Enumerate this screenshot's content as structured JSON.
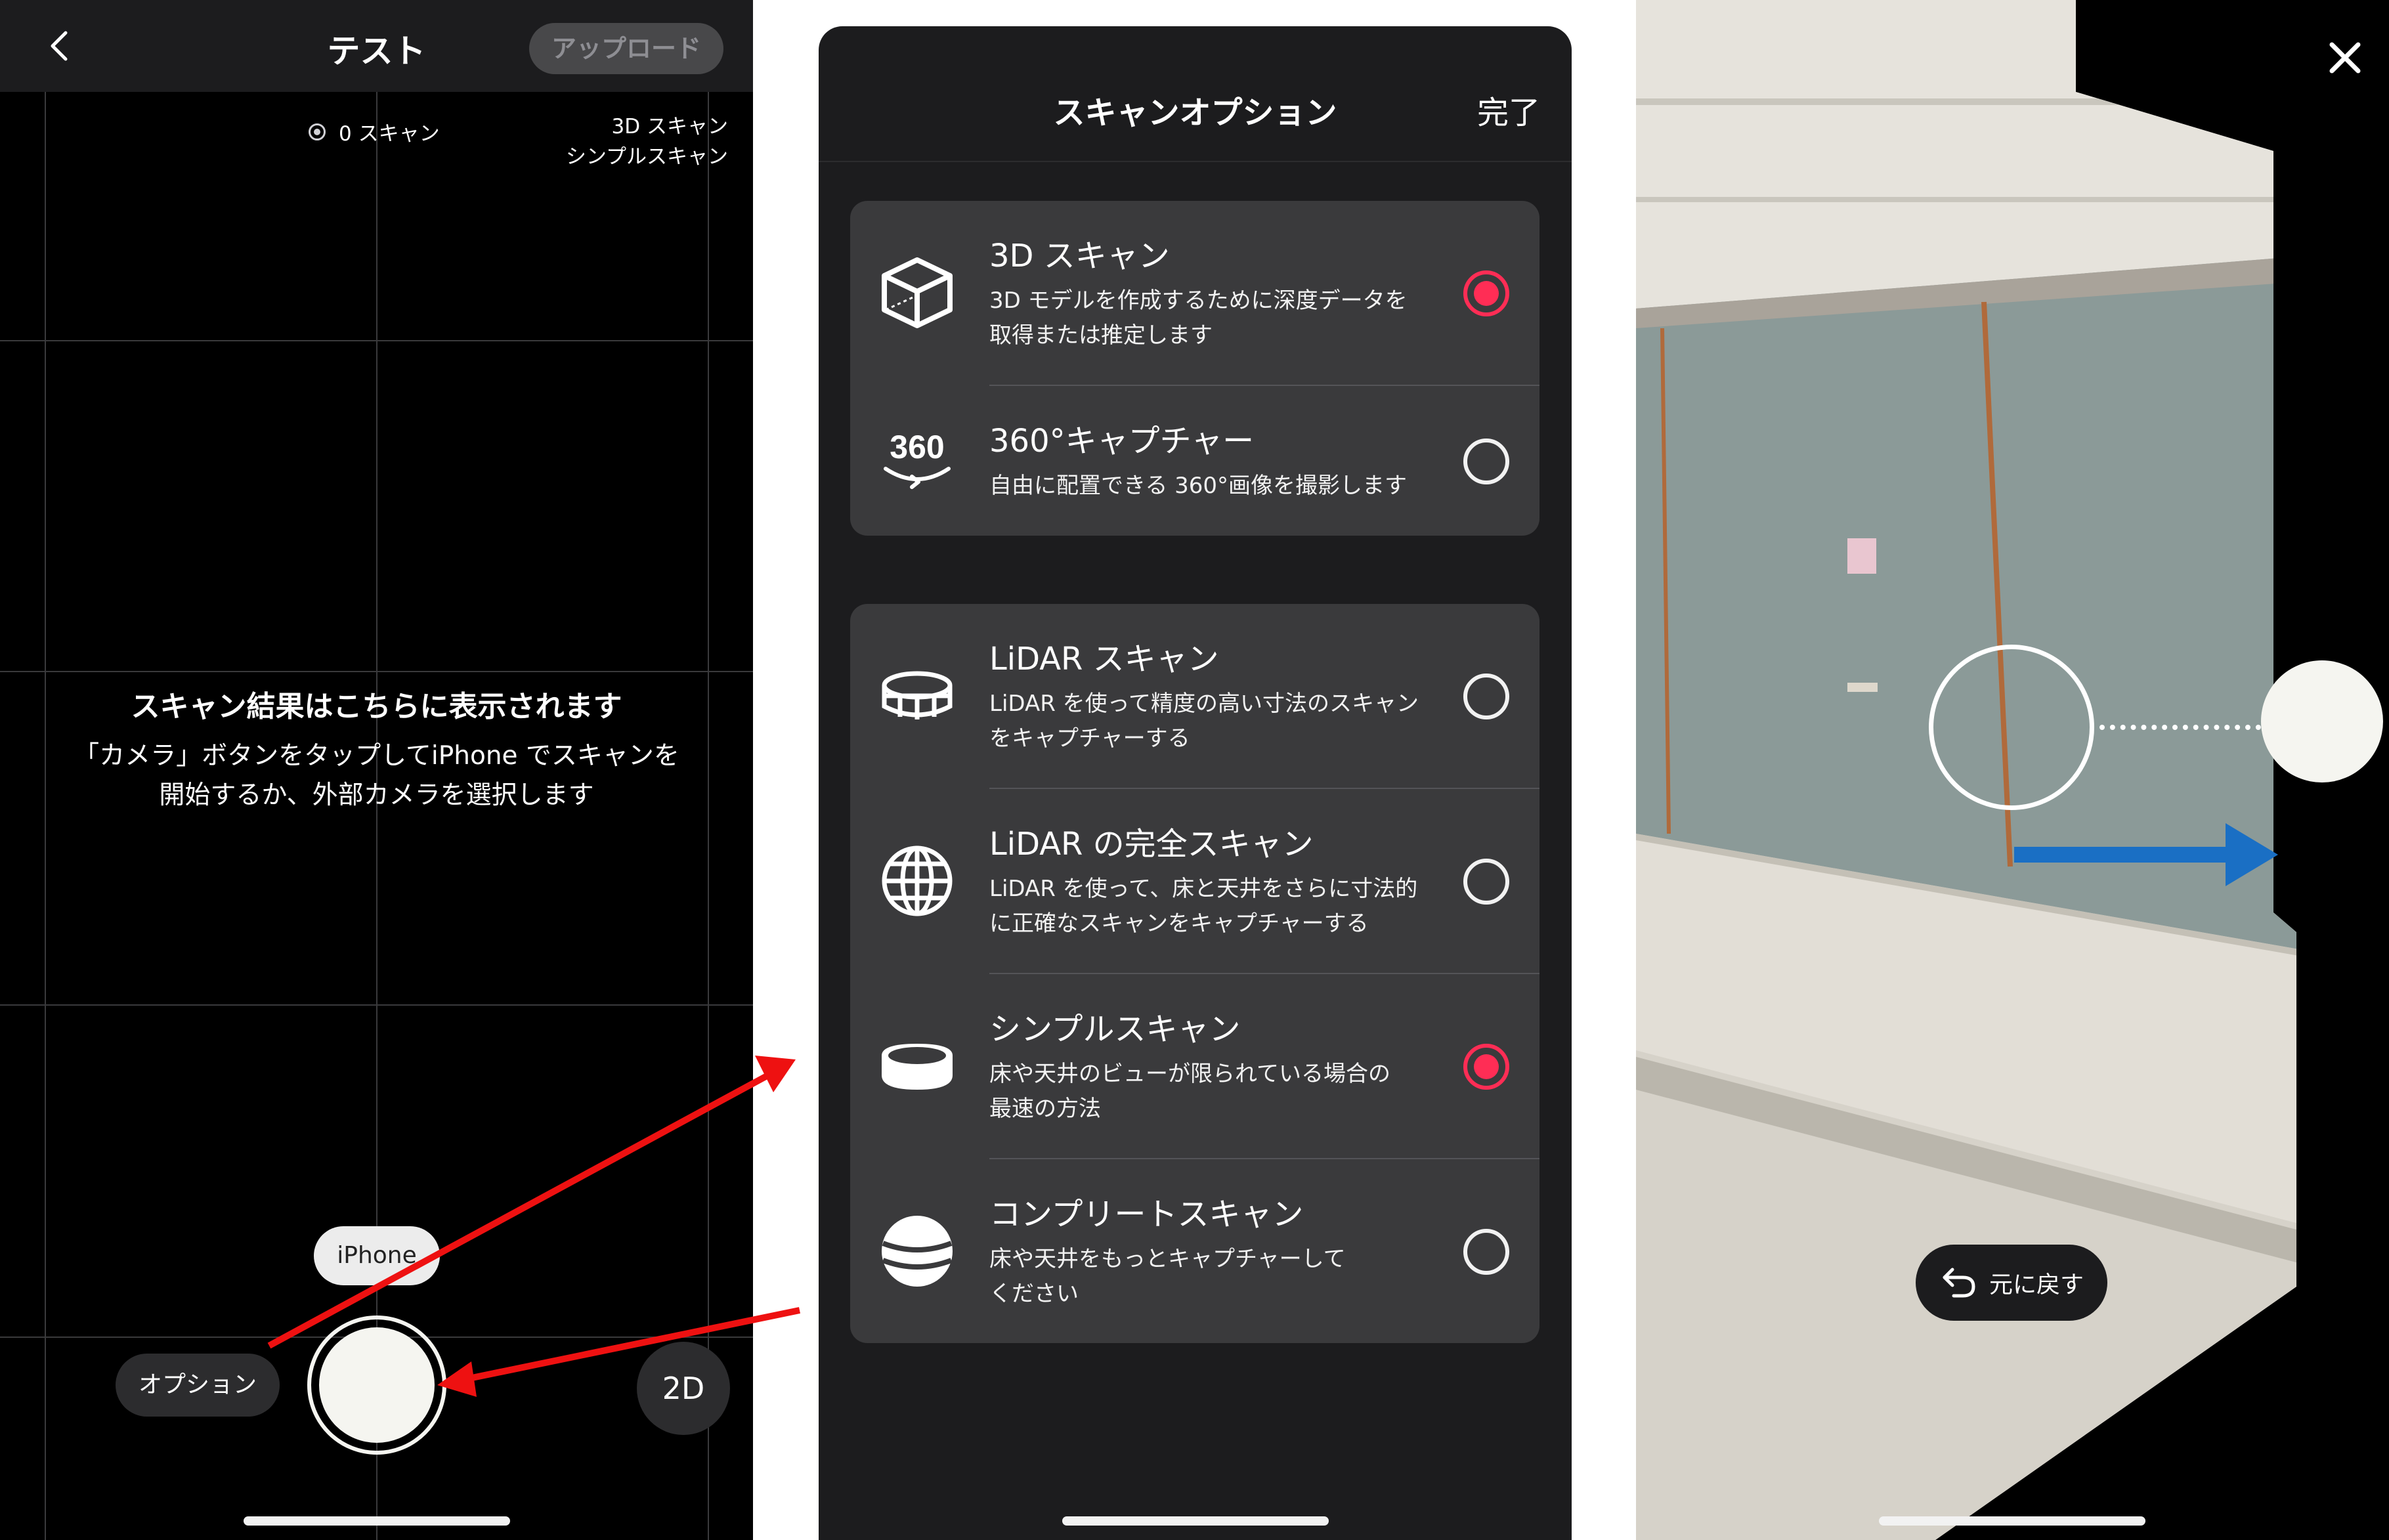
{
  "camera_screen": {
    "back_label": "<",
    "title": "テスト",
    "upload_label": "アップロード",
    "scan_count": "0 スキャン",
    "scan_modes": [
      "3D スキャン",
      "シンプルスキャン"
    ],
    "empty_title": "スキャン結果はこちらに表示されます",
    "empty_desc_line1": "「カメラ」ボタンをタップしてiPhone でスキャンを",
    "empty_desc_line2": "開始するか、外部カメラを選択します",
    "camera_source": "iPhone",
    "option_label": "オプション",
    "mode_2d_label": "2D"
  },
  "scan_options": {
    "title": "スキャンオプション",
    "done_label": "完了",
    "capture_types": [
      {
        "icon": "cube-icon",
        "title": "3D スキャン",
        "desc_line1": "3D モデルを作成するために深度データを",
        "desc_line2": "取得または推定します",
        "selected": true
      },
      {
        "icon": "360-capture-icon",
        "title": "360°キャプチャー",
        "desc_line1": "自由に配置できる 360°画像を撮影します",
        "desc_line2": "",
        "selected": false
      }
    ],
    "scan_modes": [
      {
        "icon": "lidar-scan-icon",
        "title": "LiDAR スキャン",
        "desc_line1": "LiDAR を使って精度の高い寸法のスキャン",
        "desc_line2": "をキャプチャーする",
        "selected": false
      },
      {
        "icon": "globe-icon",
        "title": "LiDAR の完全スキャン",
        "desc_line1": "LiDAR を使って、床と天井をさらに寸法的",
        "desc_line2": "に正確なスキャンをキャプチャーする",
        "selected": false
      },
      {
        "icon": "simple-scan-icon",
        "title": "シンプルスキャン",
        "desc_line1": "床や天井のビューが限られている場合の",
        "desc_line2": "最速の方法",
        "selected": true
      },
      {
        "icon": "complete-scan-icon",
        "title": "コンプリートスキャン",
        "desc_line1": "床や天井をもっとキャプチャーして",
        "desc_line2": "ください",
        "selected": false
      }
    ],
    "selected_color": "#ff2d55"
  },
  "capture_screen": {
    "close_label": "×",
    "undo_label": "元に戻す",
    "arrow_color": "#1a6fc4"
  },
  "annotation_color": "#ee1111"
}
